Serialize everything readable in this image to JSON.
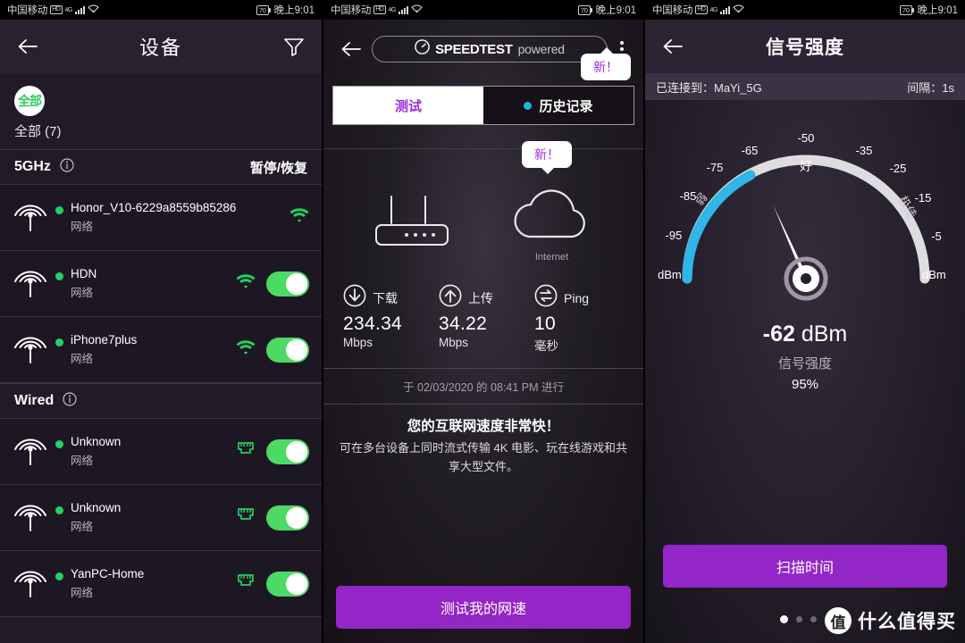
{
  "statusbar": {
    "carrier": "中国移动",
    "hd": "HD",
    "net": "4G",
    "battery": "70",
    "time": "晚上9:01"
  },
  "devices_panel": {
    "back_icon": "back-arrow-icon",
    "title": "设备",
    "filter_icon": "filter-icon",
    "all_badge": "全部",
    "all_label": "全部 (7)",
    "sections": [
      {
        "title": "5GHz",
        "info_icon": "info-icon",
        "action_label": "暂停/恢复",
        "devices": [
          {
            "name": "Honor_V10-6229a8559b85286",
            "sub": "网络",
            "link_icon": "wifi-icon",
            "toggle": false
          },
          {
            "name": "HDN",
            "sub": "网络",
            "link_icon": "wifi-icon",
            "toggle": true
          },
          {
            "name": "iPhone7plus",
            "sub": "网络",
            "link_icon": "wifi-icon",
            "toggle": true
          }
        ]
      },
      {
        "title": "Wired",
        "info_icon": "info-icon",
        "action_label": "",
        "devices": [
          {
            "name": "Unknown",
            "sub": "网络",
            "link_icon": "ethernet-icon",
            "toggle": true
          },
          {
            "name": "Unknown",
            "sub": "网络",
            "link_icon": "ethernet-icon",
            "toggle": true
          },
          {
            "name": "YanPC-Home",
            "sub": "网络",
            "link_icon": "ethernet-icon",
            "toggle": true
          }
        ]
      }
    ],
    "colors": {
      "accent_green": "#23d160",
      "toggle_on": "#4cd964",
      "header_bg": "#2a2130"
    }
  },
  "speedtest_panel": {
    "back_icon": "back-arrow-icon",
    "brand": "SPEEDTEST",
    "brand_suffix": "powered",
    "menu_icon": "overflow-menu-icon",
    "tabs": [
      {
        "label": "测试",
        "active": true
      },
      {
        "label": "历史记录",
        "active": false,
        "dot": true
      }
    ],
    "badge_top": "新！",
    "badge_bottom": "新！",
    "diagram": {
      "router_icon": "router-icon",
      "cloud_icon": "cloud-icon",
      "cloud_label": "Internet"
    },
    "metrics": [
      {
        "icon": "download-arrow-icon",
        "label": "下载",
        "value": "234.34",
        "unit": "Mbps"
      },
      {
        "icon": "upload-arrow-icon",
        "label": "上传",
        "value": "34.22",
        "unit": "Mbps"
      },
      {
        "icon": "ping-icon",
        "label": "Ping",
        "value": "10",
        "unit": "毫秒"
      }
    ],
    "when": "于 02/03/2020 的 08:41 PM 进行",
    "verdict_title": "您的互联网速度非常快！",
    "verdict_sub": "可在多台设备上同时流式传输 4K 电影、玩在线游戏和共享大型文件。",
    "cta_label": "测试我的网速",
    "colors": {
      "purple": "#9425c6",
      "tab_text": "#9b30d9",
      "dot_blue": "#1fb6e0"
    }
  },
  "signal_panel": {
    "back_icon": "back-arrow-icon",
    "title": "信号强度",
    "connected_label": "已连接到：MaYi_5G",
    "interval_label": "间隔：1s",
    "gauge": {
      "ticks": [
        "-95",
        "-85",
        "-75",
        "-65",
        "-50",
        "-35",
        "-25",
        "-15",
        "-5"
      ],
      "unit_left": "dBm",
      "unit_right": "dBm",
      "zone_weak": "弱",
      "zone_good": "好",
      "zone_excellent": "极佳",
      "value": -62,
      "min": -95,
      "max": -5,
      "arc_color": "#2fb5e8",
      "track_color": "#dddde0"
    },
    "readout_value": "-62",
    "readout_unit": "dBm",
    "readout_label": "信号强度",
    "readout_percent": "95%",
    "cta_label": "扫描时间",
    "pager": {
      "count": 4,
      "active_index": 0
    },
    "watermark": {
      "logo": "值",
      "text": "什么值得买"
    },
    "colors": {
      "purple": "#9425c6",
      "header_bg": "#2c2333",
      "subbar_bg": "#3b3244"
    }
  }
}
